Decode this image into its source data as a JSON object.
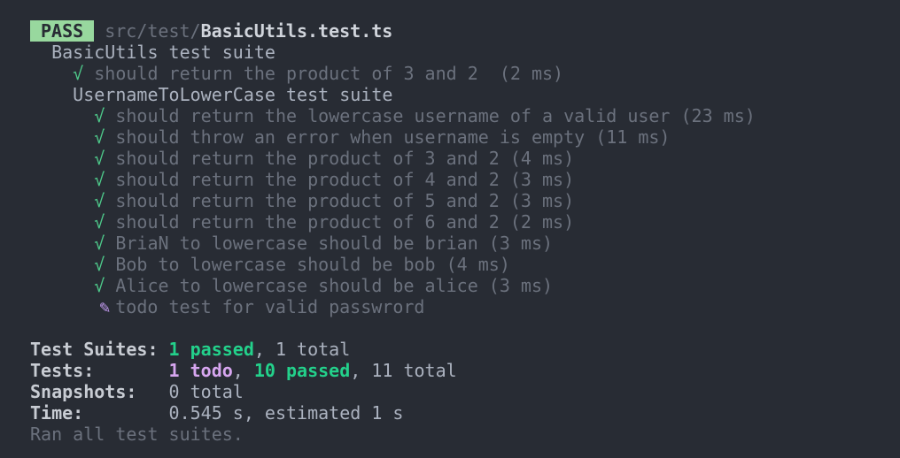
{
  "header": {
    "status": "PASS",
    "path_dir": "src/test/",
    "path_file": "BasicUtils.test.ts"
  },
  "suite": {
    "name": "BasicUtils test suite",
    "tests": [
      {
        "icon": "check-icon",
        "glyph": "√",
        "text": "should return the product of 3 and 2  (2 ms)"
      }
    ],
    "subsuite": {
      "name": "UsernameToLowerCase test suite",
      "tests": [
        {
          "icon": "check-icon",
          "glyph": "√",
          "text": "should return the lowercase username of a valid user (23 ms)"
        },
        {
          "icon": "check-icon",
          "glyph": "√",
          "text": "should throw an error when username is empty (11 ms)"
        },
        {
          "icon": "check-icon",
          "glyph": "√",
          "text": "should return the product of 3 and 2 (4 ms)"
        },
        {
          "icon": "check-icon",
          "glyph": "√",
          "text": "should return the product of 4 and 2 (3 ms)"
        },
        {
          "icon": "check-icon",
          "glyph": "√",
          "text": "should return the product of 5 and 2 (3 ms)"
        },
        {
          "icon": "check-icon",
          "glyph": "√",
          "text": "should return the product of 6 and 2 (2 ms)"
        },
        {
          "icon": "check-icon",
          "glyph": "√",
          "text": "BriaN to lowercase should be brian (3 ms)"
        },
        {
          "icon": "check-icon",
          "glyph": "√",
          "text": "Bob to lowercase should be bob (4 ms)"
        },
        {
          "icon": "check-icon",
          "glyph": "√",
          "text": "Alice to lowercase should be alice (3 ms)"
        },
        {
          "icon": "pencil-icon",
          "glyph": "✎",
          "text": "todo test for valid passwrord"
        }
      ]
    }
  },
  "summary": {
    "suites": {
      "label": "Test Suites: ",
      "passed": "1 passed",
      "rest": ", 1 total"
    },
    "tests": {
      "label": "Tests:       ",
      "todo": "1 todo",
      "sep": ", ",
      "passed": "10 passed",
      "rest": ", 11 total"
    },
    "snapshots": {
      "label": "Snapshots:   ",
      "value": "0 total"
    },
    "time": {
      "label": "Time:        ",
      "value": "0.545 s, estimated 1 s"
    },
    "footer": "Ran all test suites."
  }
}
